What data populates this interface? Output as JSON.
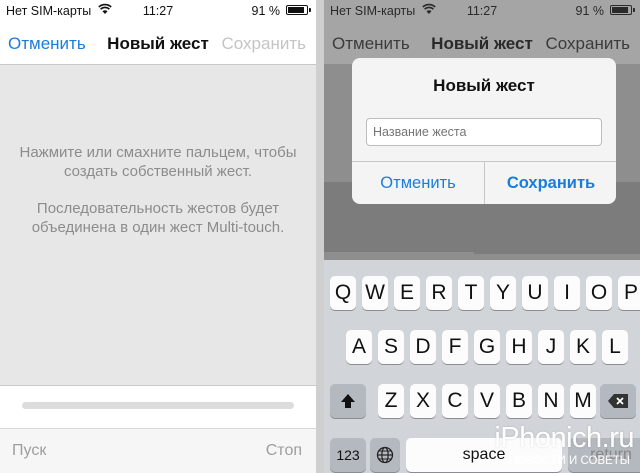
{
  "status": {
    "carrier": "Нет SIM-карты",
    "time": "11:27",
    "battery_pct": "91 %",
    "battery_level": 0.91
  },
  "navbar": {
    "cancel": "Отменить",
    "title": "Новый жест",
    "save": "Сохранить"
  },
  "canvas": {
    "instruction_1": "Нажмите или смахните пальцем, чтобы создать собственный жест.",
    "instruction_2": "Последовательность жестов будет объединена в один жест Multi-touch."
  },
  "toolbar": {
    "play": "Пуск",
    "stop": "Стоп"
  },
  "alert": {
    "title": "Новый жест",
    "name_placeholder": "Название жеста",
    "cancel": "Отменить",
    "save": "Сохранить"
  },
  "keyboard": {
    "row1": [
      "Q",
      "W",
      "E",
      "R",
      "T",
      "Y",
      "U",
      "I",
      "O",
      "P"
    ],
    "row2": [
      "A",
      "S",
      "D",
      "F",
      "G",
      "H",
      "J",
      "K",
      "L"
    ],
    "row3": [
      "Z",
      "X",
      "C",
      "V",
      "B",
      "N",
      "M"
    ],
    "numbers_label": "123",
    "space_label": "space",
    "return_label": "return"
  },
  "watermark": {
    "logo": "iPhonich.ru",
    "subtitle": "НОВОСТИ И СОВЕТЫ"
  },
  "colors": {
    "accent": "#1a7ddc",
    "disabled": "#c4c4c4"
  }
}
